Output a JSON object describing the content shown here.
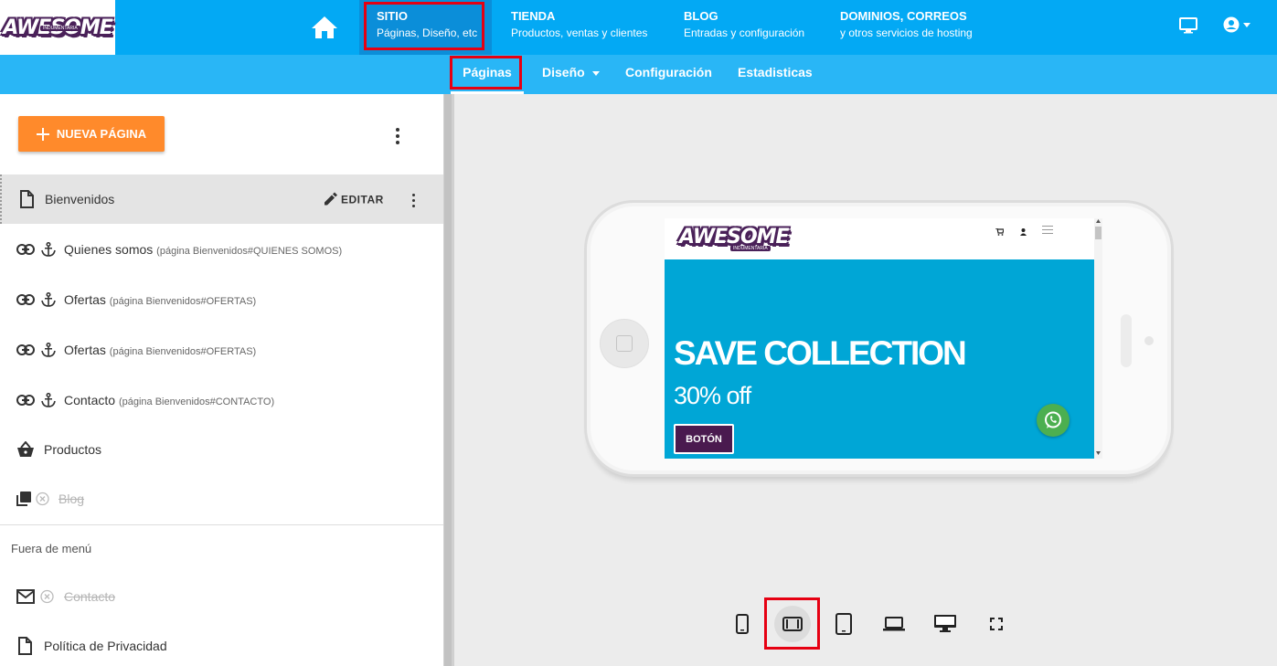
{
  "brand": {
    "logo_text": "AWESOME",
    "logo_subtext": "INDUMENTARIA"
  },
  "topnav": {
    "items": [
      {
        "title": "SITIO",
        "subtitle": "Páginas, Diseño, etc"
      },
      {
        "title": "TIENDA",
        "subtitle": "Productos, ventas y clientes"
      },
      {
        "title": "BLOG",
        "subtitle": "Entradas y configuración"
      },
      {
        "title": "DOMINIOS, CORREOS",
        "subtitle": "y otros servicios de hosting"
      }
    ]
  },
  "subnav": {
    "items": [
      {
        "label": "Páginas"
      },
      {
        "label": "Diseño"
      },
      {
        "label": "Configuración"
      },
      {
        "label": "Estadisticas"
      }
    ]
  },
  "sidebar": {
    "new_page_label": "NUEVA PÁGINA",
    "edit_label": "EDITAR",
    "pages": [
      {
        "label": "Bienvenidos",
        "hint": ""
      },
      {
        "label": "Quienes somos",
        "hint": "(página Bienvenidos#QUIENES SOMOS)"
      },
      {
        "label": "Ofertas",
        "hint": "(página Bienvenidos#OFERTAS)"
      },
      {
        "label": "Ofertas",
        "hint": "(página Bienvenidos#OFERTAS)"
      },
      {
        "label": "Contacto",
        "hint": "(página Bienvenidos#CONTACTO)"
      },
      {
        "label": "Productos",
        "hint": ""
      },
      {
        "label": "Blog",
        "hint": ""
      }
    ],
    "off_menu_label": "Fuera de menú",
    "off_menu_pages": [
      {
        "label": "Contacto"
      },
      {
        "label": "Política de Privacidad"
      }
    ]
  },
  "preview": {
    "hero_title": "SAVE COLLECTION",
    "hero_subtitle": "30% off",
    "hero_button": "BOTÓN"
  },
  "colors": {
    "topbar": "#03a9f4",
    "topbar_active": "#0b8ed9",
    "subnav": "#29b6f6",
    "accent_orange": "#ff8a2b",
    "hero_bg": "#00a6d6",
    "brand_purple": "#4a2159",
    "highlight_red": "#e60012"
  },
  "icons": [
    "home-icon",
    "desktop-icon",
    "account-icon",
    "plus-icon",
    "more-vert-icon",
    "file-icon",
    "pencil-icon",
    "link-icon",
    "anchor-icon",
    "basket-icon",
    "books-icon",
    "cancel-circle-icon",
    "mail-icon",
    "phone-portrait-icon",
    "phone-landscape-icon",
    "tablet-icon",
    "laptop-icon",
    "monitor-icon",
    "fullscreen-icon",
    "whatsapp-icon",
    "cart-icon",
    "user-icon",
    "menu-icon"
  ]
}
